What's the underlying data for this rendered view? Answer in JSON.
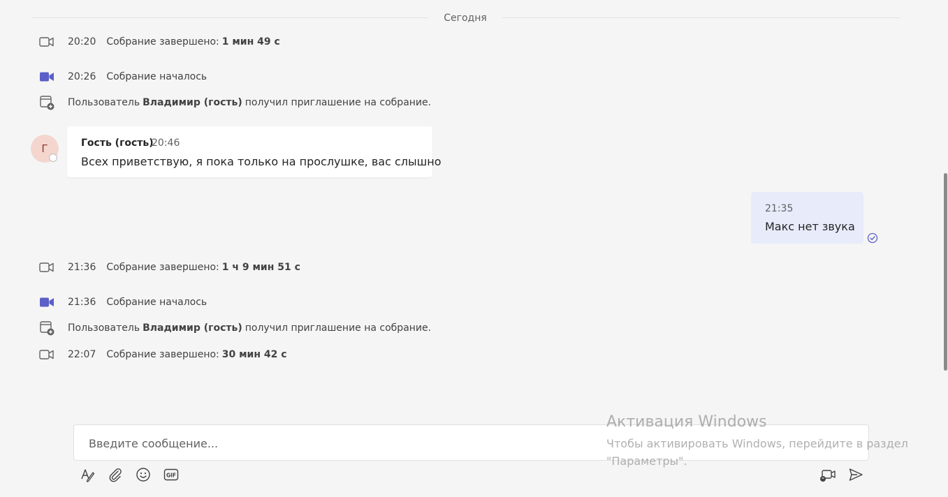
{
  "date_divider": "Сегодня",
  "events": [
    {
      "time": "20:20",
      "text": "Собрание завершено:",
      "bold": "1 мин 49 с",
      "icon": "video-outline-icon"
    },
    {
      "time": "20:26",
      "text": "Собрание началось",
      "bold": "",
      "icon": "video-filled-icon"
    },
    {
      "prefix": "Пользователь",
      "bold": "Владимир (гость)",
      "suffix": "получил приглашение на собрание.",
      "icon": "calendar-add-icon"
    },
    {
      "time": "21:36",
      "text": "Собрание завершено:",
      "bold": "1 ч 9 мин 51 с",
      "icon": "video-outline-icon"
    },
    {
      "time": "21:36",
      "text": "Собрание началось",
      "bold": "",
      "icon": "video-filled-icon"
    },
    {
      "prefix": "Пользователь",
      "bold": "Владимир (гость)",
      "suffix": "получил приглашение на собрание.",
      "icon": "calendar-add-icon"
    },
    {
      "time": "22:07",
      "text": "Собрание завершено:",
      "bold": "30 мин 42 с",
      "icon": "video-outline-icon"
    }
  ],
  "incoming_message": {
    "avatar_initial": "Г",
    "author": "Гость (гость)",
    "time": "20:46",
    "text": "Всех приветствую, я пока только на прослушке, вас слышно"
  },
  "outgoing_message": {
    "time": "21:35",
    "text": "Макс нет звука",
    "status_icon": "read-check-icon"
  },
  "compose": {
    "placeholder": "Введите сообщение..."
  },
  "toolbar": {
    "left": [
      "format-icon",
      "attach-icon",
      "emoji-icon",
      "gif-icon"
    ],
    "right": [
      "meet-now-icon",
      "send-icon"
    ]
  },
  "watermark": {
    "title": "Активация Windows",
    "line1": "Чтобы активировать Windows, перейдите в раздел",
    "line2": "\"Параметры\"."
  },
  "colors": {
    "accent": "#5b5fc7",
    "outgoing_bubble": "#e8ebfa",
    "avatar_bg": "#f4d6cf"
  }
}
